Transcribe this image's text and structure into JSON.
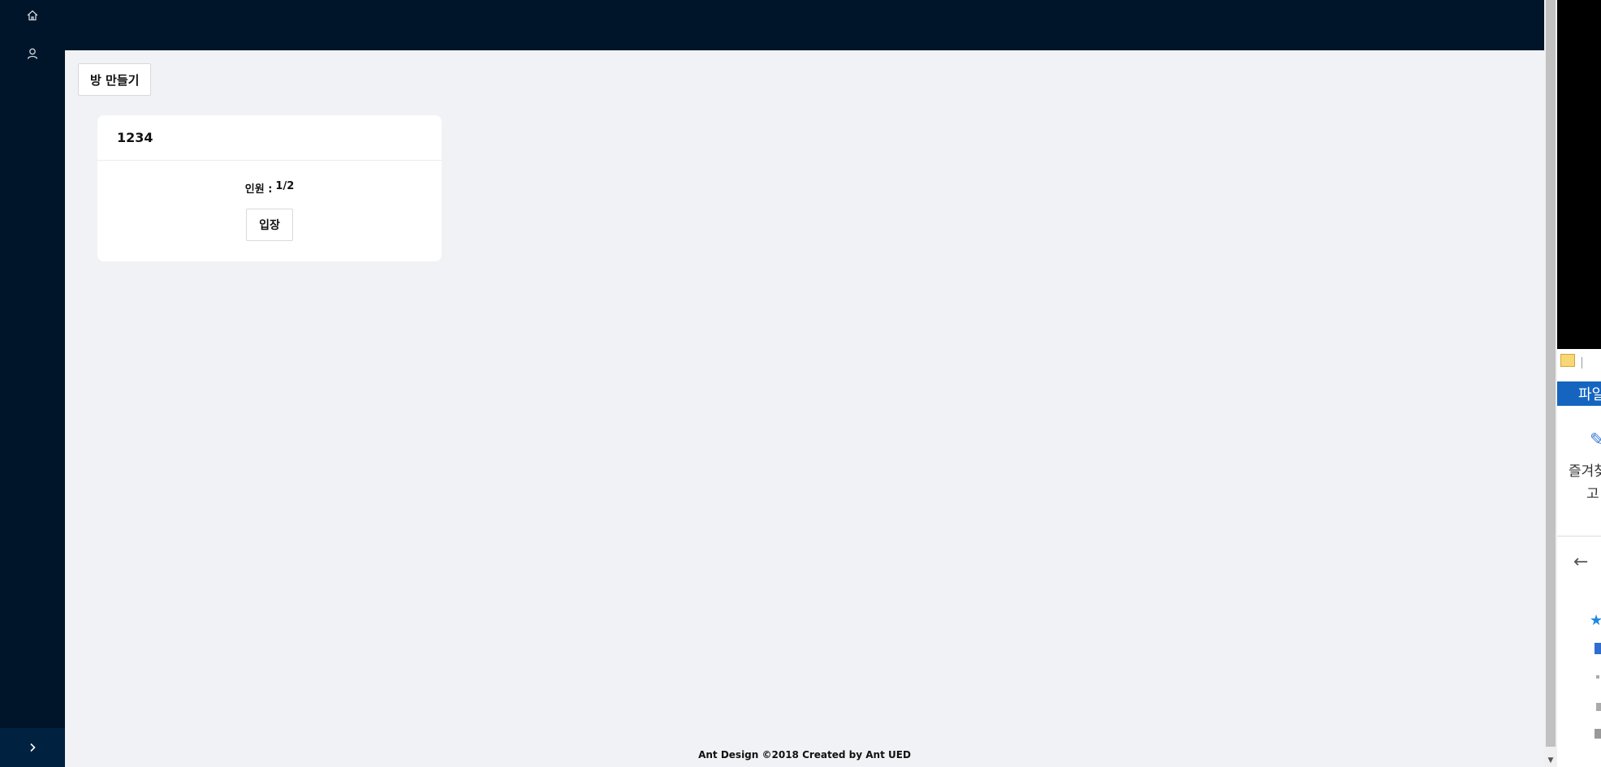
{
  "sidebar": {
    "items": [
      {
        "icon": "home-icon"
      },
      {
        "icon": "user-icon"
      }
    ],
    "collapse_icon": "chevron-right-icon"
  },
  "toolbar": {
    "create_room_label": "방 만들기"
  },
  "rooms": [
    {
      "name": "1234",
      "members_label": "인원 :",
      "members_value": "1/2",
      "enter_label": "입장"
    }
  ],
  "footer": {
    "text": "Ant Design ©2018 Created by Ant UED"
  },
  "side_window": {
    "ribbon_tab_label": "파일",
    "favorites_line1": "즐겨찾",
    "favorites_line2": "고"
  },
  "colors": {
    "sidebar_bg": "#001529",
    "content_bg": "#f0f2f5",
    "ribbon_blue": "#1565c0"
  }
}
